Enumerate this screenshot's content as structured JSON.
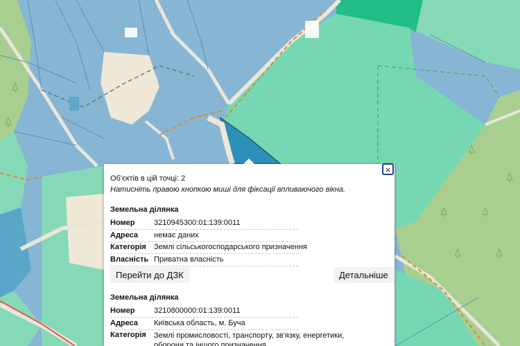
{
  "popup": {
    "objects_count": "Об'єктів в цій точці: 2",
    "hint": "Натисніть правою кнопкою миші для фіксації впливаючого вікна.",
    "close_label": "×",
    "parcels": [
      {
        "title": "Земельна ділянка",
        "rows": [
          {
            "key": "Номер",
            "value": "3210945300:01:139:0011"
          },
          {
            "key": "Адреса",
            "value": "немає даних"
          },
          {
            "key": "Категорія",
            "value": "Землі сільськогосподарського призначення"
          },
          {
            "key": "Власність",
            "value": "Приватна власність"
          }
        ],
        "goto_label": "Перейти до ДЗК",
        "details_label": "Детальніше"
      },
      {
        "title": "Земельна ділянка",
        "rows": [
          {
            "key": "Номер",
            "value": "3210800000:01:139:0011"
          },
          {
            "key": "Адреса",
            "value": "Київська область, м. Буча"
          },
          {
            "key": "Категорія",
            "value": "Землі промисловості, транспорту, зв'язку, енергетики, оборони та іншого призначення"
          }
        ]
      }
    ]
  },
  "colors": {
    "parcel_blue": "#85b5d4",
    "parcel_green": "#76d8b3",
    "forest": "#a7cf8d",
    "road_light": "#f0ead8",
    "route_dashed": "#d8893a",
    "selected_parcel": "#2e8fb8"
  }
}
